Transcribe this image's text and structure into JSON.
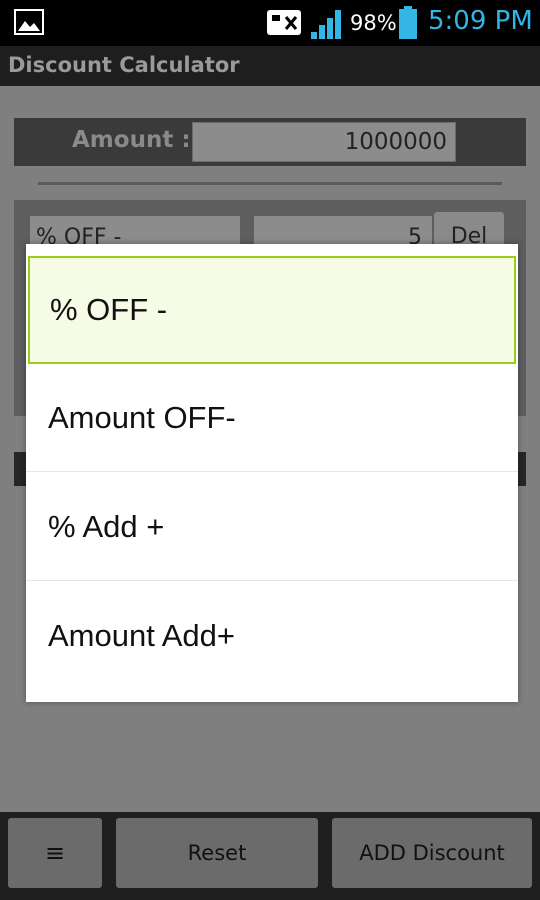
{
  "status_bar": {
    "battery_percent": "98%",
    "time": "5:09 PM",
    "icons": [
      "gallery-icon",
      "no-sim-icon",
      "signal-icon",
      "battery-icon"
    ],
    "time_color": "#33b5e5"
  },
  "app": {
    "title": "Discount Calculator"
  },
  "main": {
    "amount_label": "Amount :",
    "amount_value": "1000000",
    "discount": {
      "type": "% OFF -",
      "value": "5",
      "delete_label": "Del"
    }
  },
  "dialog": {
    "options": [
      {
        "label": "% OFF -",
        "selected": true
      },
      {
        "label": "Amount OFF-",
        "selected": false
      },
      {
        "label": "% Add +",
        "selected": false
      },
      {
        "label": "Amount Add+",
        "selected": false
      }
    ],
    "selected_border_color": "#9ccc1b"
  },
  "bottom_bar": {
    "menu_label": "≡",
    "reset_label": "Reset",
    "add_discount_label": "ADD Discount"
  }
}
